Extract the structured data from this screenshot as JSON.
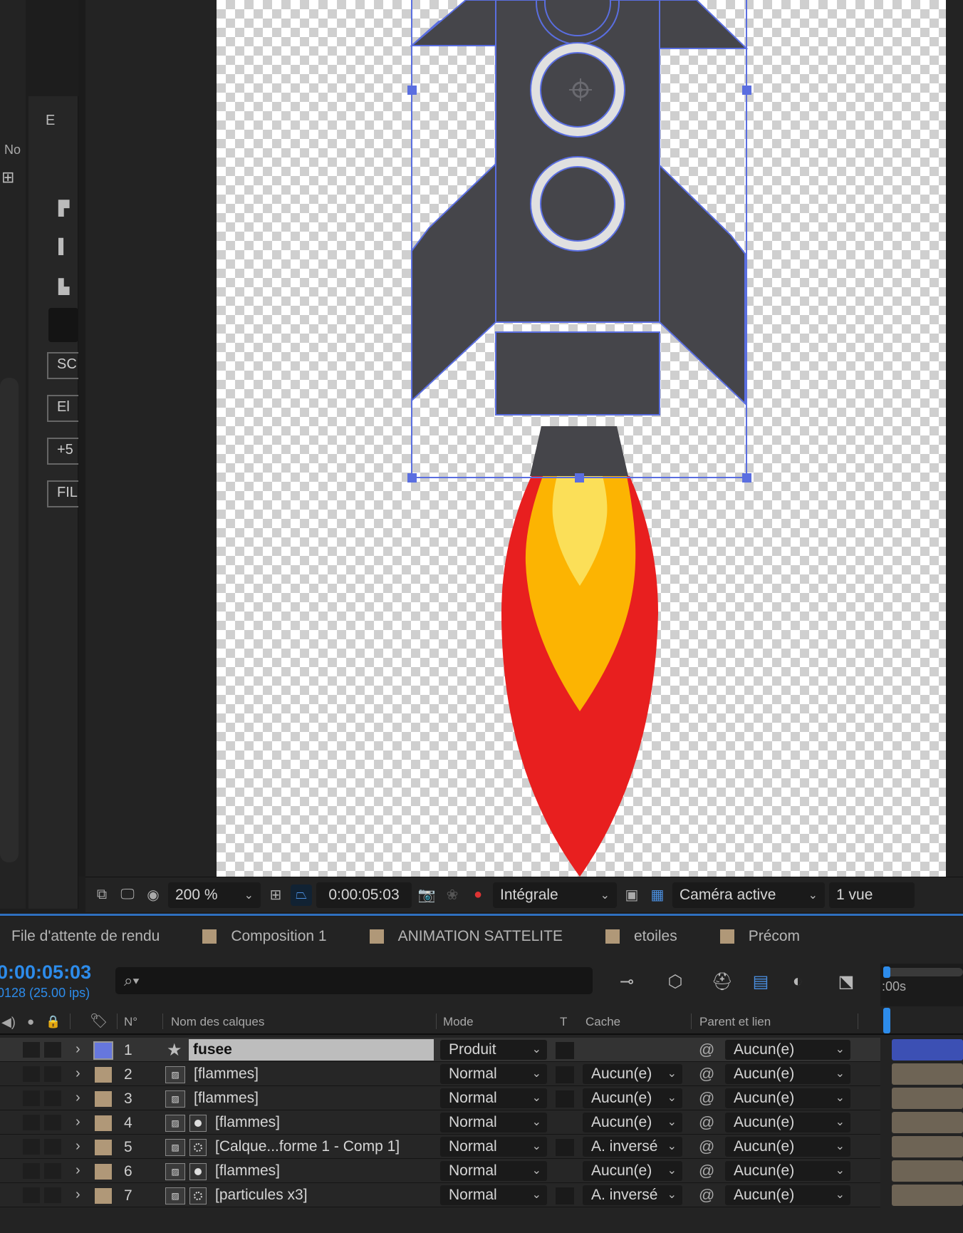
{
  "left_panel": {
    "no_label": "No",
    "e_label": "E",
    "buttons": [
      "SC",
      "El",
      "+5",
      "FIL"
    ]
  },
  "viewer": {
    "zoom": "200 %",
    "timecode": "0:00:05:03",
    "resolution": "Intégrale",
    "camera": "Caméra active",
    "views": "1 vue"
  },
  "tabs": [
    {
      "label": "File d'attente de rendu",
      "color": null
    },
    {
      "label": "Composition 1",
      "color": "#b09878"
    },
    {
      "label": "ANIMATION SATTELITE",
      "color": "#b09878"
    },
    {
      "label": "etoiles",
      "color": "#b09878"
    },
    {
      "label": "Précom",
      "color": "#b09878"
    }
  ],
  "timeline": {
    "timecode": "0:00:05:03",
    "frames": "0128 (25.00 ips)",
    "ruler_label": ":00s",
    "columns": {
      "number": "N°",
      "name": "Nom des calques",
      "mode": "Mode",
      "t": "T",
      "cache": "Cache",
      "parent": "Parent et lien"
    },
    "layers": [
      {
        "num": "1",
        "name": "fusee",
        "mode": "Produit",
        "cache": "",
        "parent": "Aucun(e)",
        "label_color": "#6677dd",
        "type": "star",
        "selected": true
      },
      {
        "num": "2",
        "name": "[flammes]",
        "mode": "Normal",
        "cache": "Aucun(e)",
        "parent": "Aucun(e)",
        "label_color": "#b09878",
        "type": "comp"
      },
      {
        "num": "3",
        "name": "[flammes]",
        "mode": "Normal",
        "cache": "Aucun(e)",
        "parent": "Aucun(e)",
        "label_color": "#b09878",
        "type": "comp"
      },
      {
        "num": "4",
        "name": "[flammes]",
        "mode": "Normal",
        "cache": "Aucun(e)",
        "parent": "Aucun(e)",
        "label_color": "#b09878",
        "type": "comp-dot"
      },
      {
        "num": "5",
        "name": "[Calque...forme 1 - Comp 1]",
        "mode": "Normal",
        "cache": "A. inversé",
        "parent": "Aucun(e)",
        "label_color": "#b09878",
        "type": "comp-ring"
      },
      {
        "num": "6",
        "name": "[flammes]",
        "mode": "Normal",
        "cache": "Aucun(e)",
        "parent": "Aucun(e)",
        "label_color": "#b09878",
        "type": "comp-dot"
      },
      {
        "num": "7",
        "name": "[particules x3]",
        "mode": "Normal",
        "cache": "A. inversé",
        "parent": "Aucun(e)",
        "label_color": "#b09878",
        "type": "comp-ring"
      }
    ]
  },
  "colors": {
    "rocket_body": "#45454a",
    "selection": "#5a6ee0",
    "flame_red": "#e81f1f",
    "flame_orange": "#fcb402",
    "flame_yellow": "#fbdf58",
    "timecode_blue": "#2d8ceb"
  }
}
